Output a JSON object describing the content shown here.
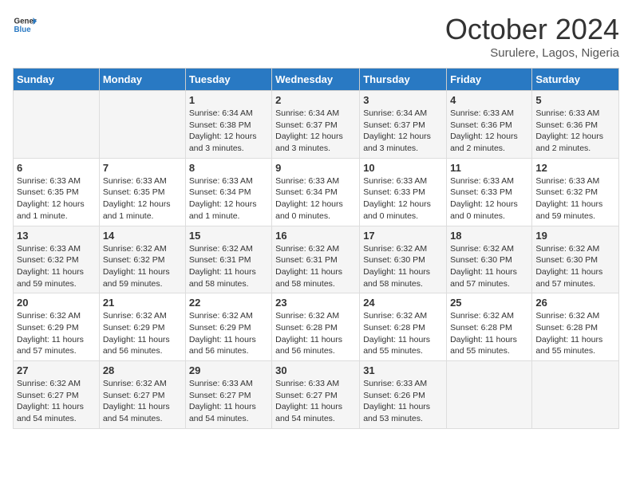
{
  "header": {
    "logo_line1": "General",
    "logo_line2": "Blue",
    "month": "October 2024",
    "location": "Surulere, Lagos, Nigeria"
  },
  "days_of_week": [
    "Sunday",
    "Monday",
    "Tuesday",
    "Wednesday",
    "Thursday",
    "Friday",
    "Saturday"
  ],
  "weeks": [
    [
      {
        "day": "",
        "detail": ""
      },
      {
        "day": "",
        "detail": ""
      },
      {
        "day": "1",
        "detail": "Sunrise: 6:34 AM\nSunset: 6:38 PM\nDaylight: 12 hours and 3 minutes."
      },
      {
        "day": "2",
        "detail": "Sunrise: 6:34 AM\nSunset: 6:37 PM\nDaylight: 12 hours and 3 minutes."
      },
      {
        "day": "3",
        "detail": "Sunrise: 6:34 AM\nSunset: 6:37 PM\nDaylight: 12 hours and 3 minutes."
      },
      {
        "day": "4",
        "detail": "Sunrise: 6:33 AM\nSunset: 6:36 PM\nDaylight: 12 hours and 2 minutes."
      },
      {
        "day": "5",
        "detail": "Sunrise: 6:33 AM\nSunset: 6:36 PM\nDaylight: 12 hours and 2 minutes."
      }
    ],
    [
      {
        "day": "6",
        "detail": "Sunrise: 6:33 AM\nSunset: 6:35 PM\nDaylight: 12 hours and 1 minute."
      },
      {
        "day": "7",
        "detail": "Sunrise: 6:33 AM\nSunset: 6:35 PM\nDaylight: 12 hours and 1 minute."
      },
      {
        "day": "8",
        "detail": "Sunrise: 6:33 AM\nSunset: 6:34 PM\nDaylight: 12 hours and 1 minute."
      },
      {
        "day": "9",
        "detail": "Sunrise: 6:33 AM\nSunset: 6:34 PM\nDaylight: 12 hours and 0 minutes."
      },
      {
        "day": "10",
        "detail": "Sunrise: 6:33 AM\nSunset: 6:33 PM\nDaylight: 12 hours and 0 minutes."
      },
      {
        "day": "11",
        "detail": "Sunrise: 6:33 AM\nSunset: 6:33 PM\nDaylight: 12 hours and 0 minutes."
      },
      {
        "day": "12",
        "detail": "Sunrise: 6:33 AM\nSunset: 6:32 PM\nDaylight: 11 hours and 59 minutes."
      }
    ],
    [
      {
        "day": "13",
        "detail": "Sunrise: 6:33 AM\nSunset: 6:32 PM\nDaylight: 11 hours and 59 minutes."
      },
      {
        "day": "14",
        "detail": "Sunrise: 6:32 AM\nSunset: 6:32 PM\nDaylight: 11 hours and 59 minutes."
      },
      {
        "day": "15",
        "detail": "Sunrise: 6:32 AM\nSunset: 6:31 PM\nDaylight: 11 hours and 58 minutes."
      },
      {
        "day": "16",
        "detail": "Sunrise: 6:32 AM\nSunset: 6:31 PM\nDaylight: 11 hours and 58 minutes."
      },
      {
        "day": "17",
        "detail": "Sunrise: 6:32 AM\nSunset: 6:30 PM\nDaylight: 11 hours and 58 minutes."
      },
      {
        "day": "18",
        "detail": "Sunrise: 6:32 AM\nSunset: 6:30 PM\nDaylight: 11 hours and 57 minutes."
      },
      {
        "day": "19",
        "detail": "Sunrise: 6:32 AM\nSunset: 6:30 PM\nDaylight: 11 hours and 57 minutes."
      }
    ],
    [
      {
        "day": "20",
        "detail": "Sunrise: 6:32 AM\nSunset: 6:29 PM\nDaylight: 11 hours and 57 minutes."
      },
      {
        "day": "21",
        "detail": "Sunrise: 6:32 AM\nSunset: 6:29 PM\nDaylight: 11 hours and 56 minutes."
      },
      {
        "day": "22",
        "detail": "Sunrise: 6:32 AM\nSunset: 6:29 PM\nDaylight: 11 hours and 56 minutes."
      },
      {
        "day": "23",
        "detail": "Sunrise: 6:32 AM\nSunset: 6:28 PM\nDaylight: 11 hours and 56 minutes."
      },
      {
        "day": "24",
        "detail": "Sunrise: 6:32 AM\nSunset: 6:28 PM\nDaylight: 11 hours and 55 minutes."
      },
      {
        "day": "25",
        "detail": "Sunrise: 6:32 AM\nSunset: 6:28 PM\nDaylight: 11 hours and 55 minutes."
      },
      {
        "day": "26",
        "detail": "Sunrise: 6:32 AM\nSunset: 6:28 PM\nDaylight: 11 hours and 55 minutes."
      }
    ],
    [
      {
        "day": "27",
        "detail": "Sunrise: 6:32 AM\nSunset: 6:27 PM\nDaylight: 11 hours and 54 minutes."
      },
      {
        "day": "28",
        "detail": "Sunrise: 6:32 AM\nSunset: 6:27 PM\nDaylight: 11 hours and 54 minutes."
      },
      {
        "day": "29",
        "detail": "Sunrise: 6:33 AM\nSunset: 6:27 PM\nDaylight: 11 hours and 54 minutes."
      },
      {
        "day": "30",
        "detail": "Sunrise: 6:33 AM\nSunset: 6:27 PM\nDaylight: 11 hours and 54 minutes."
      },
      {
        "day": "31",
        "detail": "Sunrise: 6:33 AM\nSunset: 6:26 PM\nDaylight: 11 hours and 53 minutes."
      },
      {
        "day": "",
        "detail": ""
      },
      {
        "day": "",
        "detail": ""
      }
    ]
  ]
}
